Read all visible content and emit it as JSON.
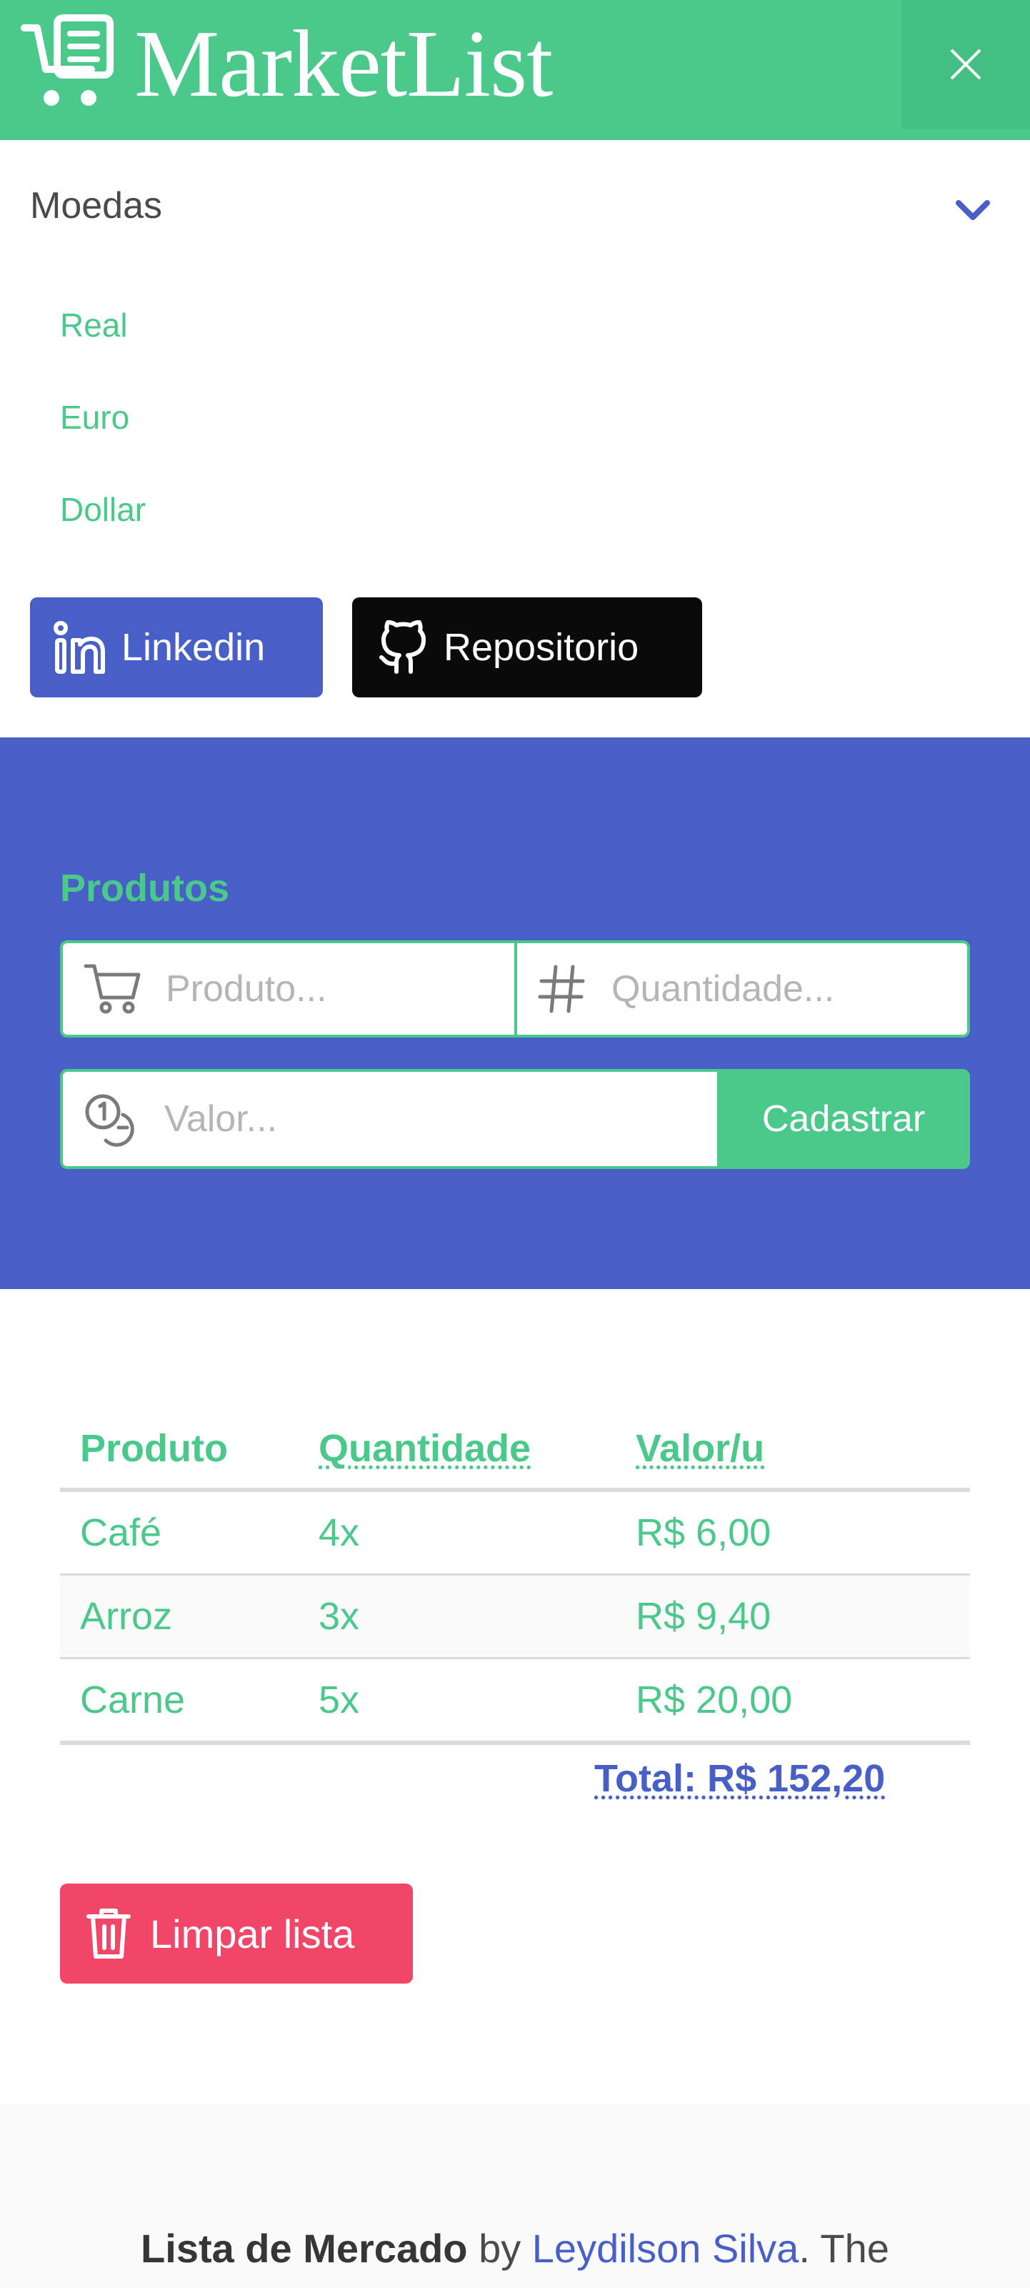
{
  "navbar": {
    "brand": "MarketList",
    "brand_icon": "cart-list-icon",
    "close_icon": "close-icon",
    "colors": {
      "background": "#4ac98b",
      "close_bg": "#44bf83"
    }
  },
  "menu": {
    "dropdown_label": "Moedas",
    "dropdown_icon": "chevron-down-icon",
    "currencies": [
      "Real",
      "Euro",
      "Dollar"
    ],
    "linkedin_label": "Linkedin",
    "repo_label": "Repositorio"
  },
  "form": {
    "title": "Produtos",
    "product_placeholder": "Produto...",
    "quantity_placeholder": "Quantidade...",
    "value_placeholder": "Valor...",
    "submit_label": "Cadastrar",
    "colors": {
      "background": "#485fc7",
      "accent": "#4ac98b"
    }
  },
  "table": {
    "headers": [
      "Produto",
      "Quantidade",
      "Valor/u"
    ],
    "rows": [
      [
        "Café",
        "4x",
        "R$ 6,00"
      ],
      [
        "Arroz",
        "3x",
        "R$ 9,40"
      ],
      [
        "Carne",
        "5x",
        "R$ 20,00"
      ]
    ],
    "total": "Total: R$ 152,20"
  },
  "actions": {
    "clear_label": "Limpar lista",
    "clear_color": "#f14668"
  },
  "footer": {
    "title": "Lista de Mercado",
    "by": " by ",
    "author": "Leydilson Silva",
    "trail": ". The"
  }
}
